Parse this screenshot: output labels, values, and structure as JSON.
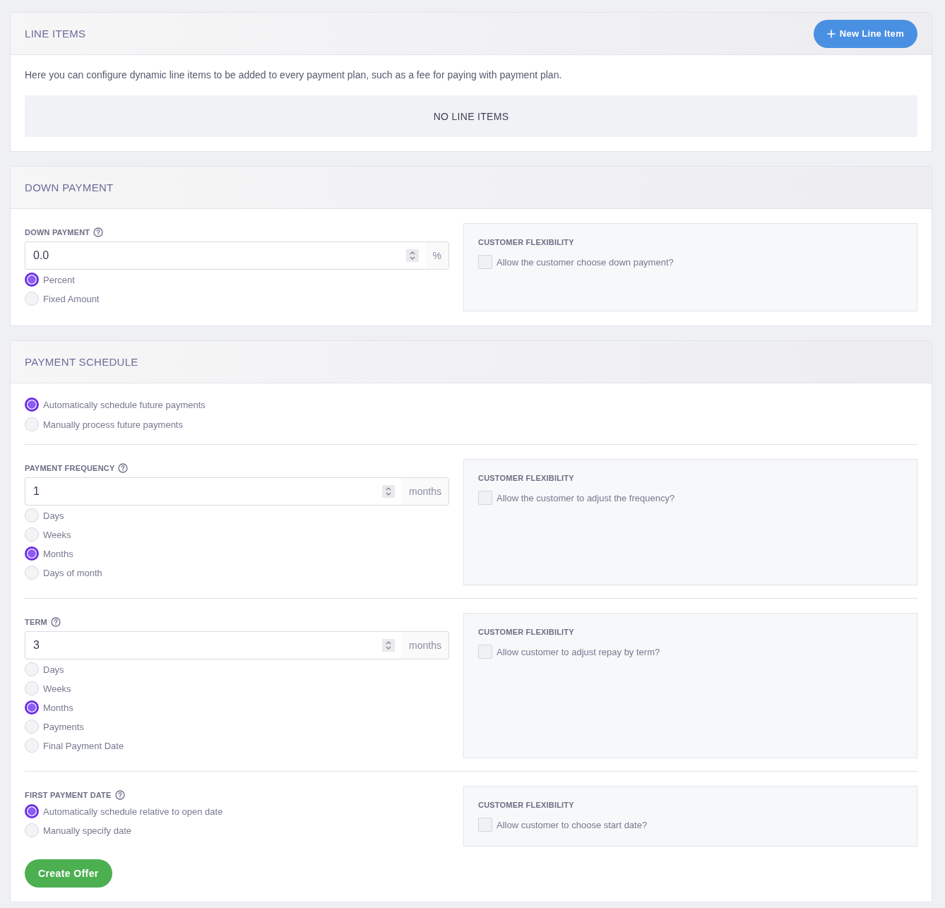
{
  "line_items": {
    "title": "LINE ITEMS",
    "new_button": "New Line Item",
    "description": "Here you can configure dynamic line items to be added to every payment plan, such as a fee for paying with payment plan.",
    "empty_text": "NO LINE ITEMS"
  },
  "down_payment": {
    "title": "DOWN PAYMENT",
    "groups": [
      {
        "label": "DOWN PAYMENT",
        "field": {
          "value": "0.0",
          "unit": "%"
        },
        "options": [
          {
            "label": "Percent",
            "selected": true
          },
          {
            "label": "Fixed Amount",
            "selected": false
          }
        ],
        "flexibility": {
          "title": "CUSTOMER FLEXIBILITY",
          "label": "Allow the customer choose down payment?",
          "checked": false
        }
      }
    ]
  },
  "payment_schedule": {
    "title": "PAYMENT SCHEDULE",
    "mode_options": [
      {
        "label": "Automatically schedule future payments",
        "selected": true
      },
      {
        "label": "Manually process future payments",
        "selected": false
      }
    ],
    "groups": [
      {
        "label": "PAYMENT FREQUENCY",
        "field": {
          "value": "1",
          "unit": "months"
        },
        "options": [
          {
            "label": "Days",
            "selected": false
          },
          {
            "label": "Weeks",
            "selected": false
          },
          {
            "label": "Months",
            "selected": true
          },
          {
            "label": "Days of month",
            "selected": false
          }
        ],
        "flexibility": {
          "title": "CUSTOMER FLEXIBILITY",
          "label": "Allow the customer to adjust the frequency?",
          "checked": false
        }
      },
      {
        "label": "TERM",
        "field": {
          "value": "3",
          "unit": "months"
        },
        "options": [
          {
            "label": "Days",
            "selected": false
          },
          {
            "label": "Weeks",
            "selected": false
          },
          {
            "label": "Months",
            "selected": true
          },
          {
            "label": "Payments",
            "selected": false
          },
          {
            "label": "Final Payment Date",
            "selected": false
          }
        ],
        "flexibility": {
          "title": "CUSTOMER FLEXIBILITY",
          "label": "Allow customer to adjust repay by term?",
          "checked": false
        }
      },
      {
        "label": "FIRST PAYMENT DATE",
        "options": [
          {
            "label": "Automatically schedule relative to open date",
            "selected": true
          },
          {
            "label": "Manually specify date",
            "selected": false
          }
        ],
        "flexibility": {
          "title": "CUSTOMER FLEXIBILITY",
          "label": "Allow customer to choose start date?",
          "checked": false
        }
      }
    ],
    "submit_button": "Create Offer"
  }
}
